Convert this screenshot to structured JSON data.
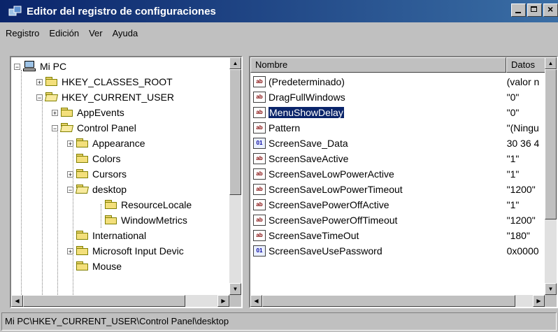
{
  "window": {
    "title": "Editor del registro de configuraciones"
  },
  "menu": [
    "Registro",
    "Edición",
    "Ver",
    "Ayuda"
  ],
  "tree": {
    "root": "Mi PC",
    "items": [
      {
        "label": "HKEY_CLASSES_ROOT"
      },
      {
        "label": "HKEY_CURRENT_USER"
      },
      {
        "label": "AppEvents"
      },
      {
        "label": "Control Panel"
      },
      {
        "label": "Appearance"
      },
      {
        "label": "Colors"
      },
      {
        "label": "Cursors"
      },
      {
        "label": "desktop"
      },
      {
        "label": "ResourceLocale"
      },
      {
        "label": "WindowMetrics"
      },
      {
        "label": "International"
      },
      {
        "label": "Microsoft Input Devic"
      },
      {
        "label": "Mouse"
      }
    ]
  },
  "list": {
    "columns": [
      "Nombre",
      "Datos"
    ],
    "rows": [
      {
        "name": "(Predeterminado)",
        "data": "(valor n",
        "type": "string"
      },
      {
        "name": "DragFullWindows",
        "data": "\"0\"",
        "type": "string"
      },
      {
        "name": "MenuShowDelay",
        "data": "\"0\"",
        "type": "string",
        "selected": true
      },
      {
        "name": "Pattern",
        "data": "\"(Ningu",
        "type": "string"
      },
      {
        "name": "ScreenSave_Data",
        "data": "30 36 4",
        "type": "binary"
      },
      {
        "name": "ScreenSaveActive",
        "data": "\"1\"",
        "type": "string"
      },
      {
        "name": "ScreenSaveLowPowerActive",
        "data": "\"1\"",
        "type": "string"
      },
      {
        "name": "ScreenSaveLowPowerTimeout",
        "data": "\"1200\"",
        "type": "string"
      },
      {
        "name": "ScreenSavePowerOffActive",
        "data": "\"1\"",
        "type": "string"
      },
      {
        "name": "ScreenSavePowerOffTimeout",
        "data": "\"1200\"",
        "type": "string"
      },
      {
        "name": "ScreenSaveTimeOut",
        "data": "\"180\"",
        "type": "string"
      },
      {
        "name": "ScreenSaveUsePassword",
        "data": "0x0000",
        "type": "binary"
      }
    ]
  },
  "status": {
    "path": "Mi PC\\HKEY_CURRENT_USER\\Control Panel\\desktop"
  },
  "colors": {
    "titlebar_start": "#0a246a",
    "titlebar_end": "#3a6ea5",
    "selection": "#0a246a",
    "face": "#c0c0c0"
  },
  "icons": [
    "registry-icon",
    "minimize-icon",
    "maximize-icon",
    "close-icon",
    "computer-icon",
    "folder-icon",
    "string-value-icon",
    "binary-value-icon"
  ]
}
